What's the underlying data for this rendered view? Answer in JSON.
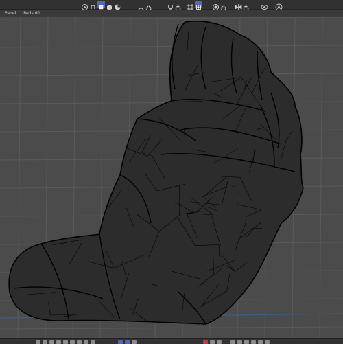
{
  "menubar": {
    "items": [
      "Panel",
      "Redshift"
    ]
  },
  "toolbar": {
    "groups": [
      {
        "icons": [
          "play-icon",
          "camera-icon",
          "cube-icon",
          "object-icon",
          "pie-icon"
        ],
        "active": [
          2
        ]
      },
      {
        "icons": [
          "axis-icon",
          "gear-icon"
        ]
      },
      {
        "icons": [
          "magnet-icon",
          "gear-icon"
        ]
      },
      {
        "icons": [
          "grid-snap-icon",
          "grid-icon"
        ],
        "active": [
          1
        ]
      },
      {
        "icons": [
          "record-icon",
          "gear-icon"
        ]
      },
      {
        "icons": [
          "symmetry-icon",
          "gear-icon"
        ]
      },
      {
        "icons": [
          "eye-icon",
          "text-a-icon"
        ]
      }
    ]
  },
  "colors": {
    "accent": "#5566b8",
    "wire": "#000000",
    "grid": "#5a5a5a",
    "background": "#4b4b4b"
  }
}
